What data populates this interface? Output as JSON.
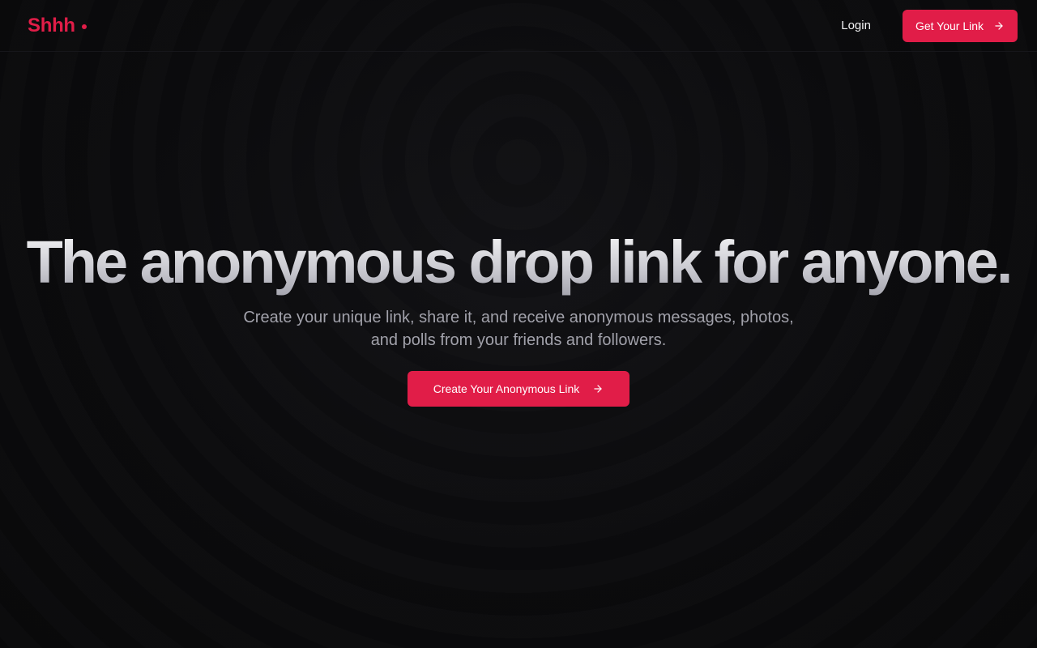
{
  "header": {
    "logo_text": "Shhh",
    "login_label": "Login",
    "cta_label": "Get Your Link"
  },
  "hero": {
    "title": "The anonymous drop link for anyone.",
    "subtitle": "Create your unique link, share it, and receive anonymous messages, photos, and polls from your friends and followers.",
    "cta_label": "Create Your Anonymous Link"
  },
  "colors": {
    "accent": "#e11d48",
    "background": "#0a0a0b",
    "subtitle_text": "#a1a1aa"
  },
  "icons": {
    "logo_dot": "dot-icon",
    "cta_arrow": "arrow-right-icon"
  }
}
